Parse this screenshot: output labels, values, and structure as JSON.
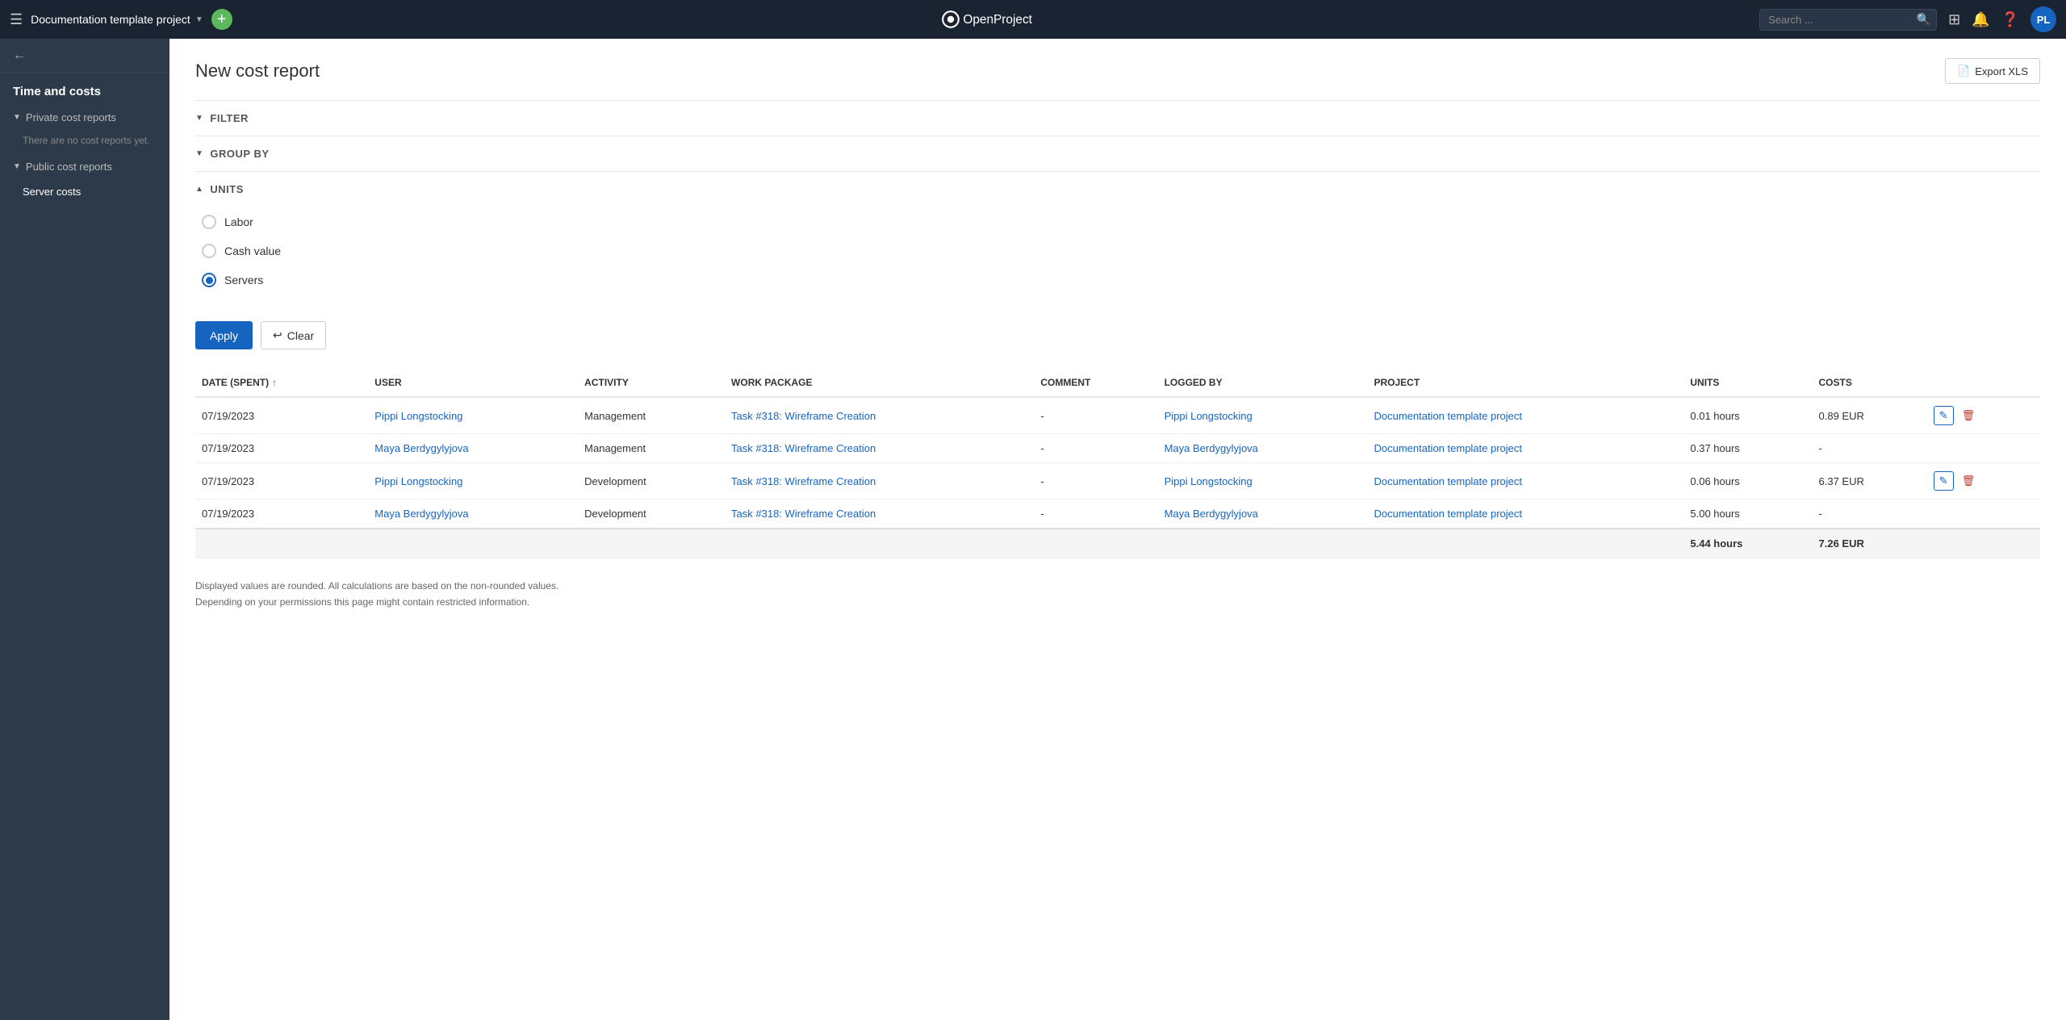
{
  "topnav": {
    "project_name": "Documentation template project",
    "add_label": "+",
    "search_placeholder": "Search ...",
    "avatar_initials": "PL"
  },
  "sidebar": {
    "back_label": "",
    "section_title": "Time and costs",
    "private_reports_label": "Private cost reports",
    "no_reports_text": "There are no cost reports yet.",
    "public_reports_label": "Public cost reports",
    "server_costs_label": "Server costs"
  },
  "page": {
    "title": "New cost report",
    "export_label": "Export XLS",
    "filter_label": "FILTER",
    "group_by_label": "GROUP BY",
    "units_label": "UNITS",
    "apply_label": "Apply",
    "clear_label": "Clear"
  },
  "units": [
    {
      "id": "labor",
      "label": "Labor",
      "checked": false
    },
    {
      "id": "cash_value",
      "label": "Cash value",
      "checked": false
    },
    {
      "id": "servers",
      "label": "Servers",
      "checked": true
    }
  ],
  "table": {
    "columns": [
      {
        "key": "date",
        "label": "DATE (SPENT)",
        "sortable": true
      },
      {
        "key": "user",
        "label": "USER",
        "sortable": false
      },
      {
        "key": "activity",
        "label": "ACTIVITY",
        "sortable": false
      },
      {
        "key": "work_package",
        "label": "WORK PACKAGE",
        "sortable": false
      },
      {
        "key": "comment",
        "label": "COMMENT",
        "sortable": false
      },
      {
        "key": "logged_by",
        "label": "LOGGED BY",
        "sortable": false
      },
      {
        "key": "project",
        "label": "PROJECT",
        "sortable": false
      },
      {
        "key": "units",
        "label": "UNITS",
        "sortable": false
      },
      {
        "key": "costs",
        "label": "COSTS",
        "sortable": false
      }
    ],
    "rows": [
      {
        "date": "07/19/2023",
        "user": "Pippi Longstocking",
        "activity": "Management",
        "work_package": "Task #318: Wireframe Creation",
        "comment": "-",
        "logged_by": "Pippi Longstocking",
        "project": "Documentation template project",
        "units": "0.01 hours",
        "costs": "0.89 EUR",
        "has_actions": true
      },
      {
        "date": "07/19/2023",
        "user": "Maya Berdygylyjova",
        "activity": "Management",
        "work_package": "Task #318: Wireframe Creation",
        "comment": "-",
        "logged_by": "Maya Berdygylyjova",
        "project": "Documentation template project",
        "units": "0.37 hours",
        "costs": "-",
        "has_actions": false
      },
      {
        "date": "07/19/2023",
        "user": "Pippi Longstocking",
        "activity": "Development",
        "work_package": "Task #318: Wireframe Creation",
        "comment": "-",
        "logged_by": "Pippi Longstocking",
        "project": "Documentation template project",
        "units": "0.06 hours",
        "costs": "6.37 EUR",
        "has_actions": true
      },
      {
        "date": "07/19/2023",
        "user": "Maya Berdygylyjova",
        "activity": "Development",
        "work_package": "Task #318: Wireframe Creation",
        "comment": "-",
        "logged_by": "Maya Berdygylyjova",
        "project": "Documentation template project",
        "units": "5.00 hours",
        "costs": "-",
        "has_actions": false
      }
    ],
    "totals": {
      "units": "5.44 hours",
      "costs": "7.26 EUR"
    }
  },
  "footer": {
    "note_line1": "Displayed values are rounded. All calculations are based on the non-rounded values.",
    "note_line2": "Depending on your permissions this page might contain restricted information."
  }
}
